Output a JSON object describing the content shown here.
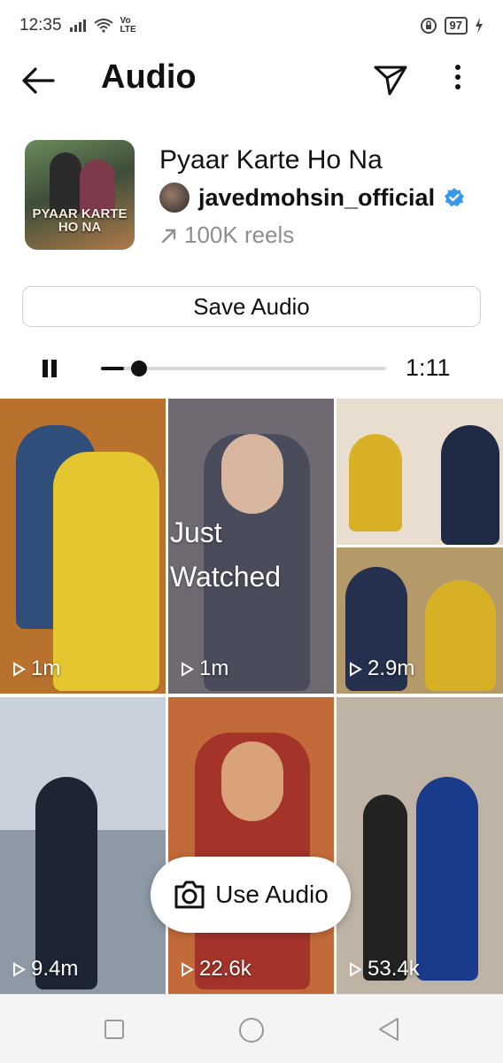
{
  "status_bar": {
    "time": "12:35",
    "network_label_top": "Vo",
    "network_label_bottom": "LTE",
    "battery": "97"
  },
  "header": {
    "title": "Audio",
    "back_icon": "arrow-left-icon",
    "send_icon": "paper-plane-icon",
    "more_icon": "vertical-dots-icon"
  },
  "audio": {
    "title": "Pyaar Karte Ho Na",
    "artist": "javedmohsin_official",
    "reels": "100K reels",
    "cover_text_line1": "PYAAR KARTE",
    "cover_text_line2": "HO NA"
  },
  "save_button": "Save Audio",
  "player": {
    "time": "1:11",
    "progress": 0.08
  },
  "reels": [
    {
      "count": "1m",
      "bg": "#b8722e"
    },
    {
      "count": "1m",
      "bg": "#6f6a72",
      "overlay_line1": "Just",
      "overlay_line2": "Watched"
    },
    {
      "count": "2.9m",
      "bg": "#b49a6a"
    },
    {
      "count": "9.4m",
      "bg": "#8d9aa6"
    },
    {
      "count": "22.6k",
      "bg": "#c36a3a"
    },
    {
      "count": "53.4k",
      "bg": "#bfb3a6"
    }
  ],
  "use_audio_button": "Use Audio",
  "colors": {
    "accent_verified": "#3897f0",
    "muted_text": "#8e8e8e"
  }
}
